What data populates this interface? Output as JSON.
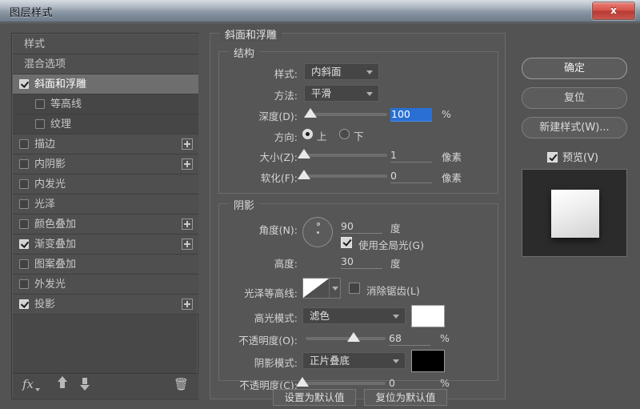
{
  "window": {
    "title": "图层样式",
    "close_label": "x"
  },
  "styles_panel": {
    "rows": [
      {
        "label": "样式",
        "type": "header",
        "checked": null,
        "plus": false,
        "selected": false
      },
      {
        "label": "混合选项",
        "type": "top",
        "checked": null,
        "plus": false,
        "selected": false
      },
      {
        "label": "斜面和浮雕",
        "type": "item",
        "checked": true,
        "plus": false,
        "selected": true
      },
      {
        "label": "等高线",
        "type": "sub",
        "checked": false,
        "plus": false,
        "selected": false
      },
      {
        "label": "纹理",
        "type": "sub",
        "checked": false,
        "plus": false,
        "selected": false
      },
      {
        "label": "描边",
        "type": "item",
        "checked": false,
        "plus": true,
        "selected": false
      },
      {
        "label": "内阴影",
        "type": "item",
        "checked": false,
        "plus": true,
        "selected": false
      },
      {
        "label": "内发光",
        "type": "item",
        "checked": false,
        "plus": false,
        "selected": false
      },
      {
        "label": "光泽",
        "type": "item",
        "checked": false,
        "plus": false,
        "selected": false
      },
      {
        "label": "颜色叠加",
        "type": "item",
        "checked": false,
        "plus": true,
        "selected": false
      },
      {
        "label": "渐变叠加",
        "type": "item",
        "checked": true,
        "plus": true,
        "selected": false
      },
      {
        "label": "图案叠加",
        "type": "item",
        "checked": false,
        "plus": false,
        "selected": false
      },
      {
        "label": "外发光",
        "type": "item",
        "checked": false,
        "plus": false,
        "selected": false
      },
      {
        "label": "投影",
        "type": "item",
        "checked": true,
        "plus": true,
        "selected": false
      }
    ],
    "toolbar": {
      "fx_label": "fx",
      "up_label": "上移效果",
      "down_label": "下移效果",
      "trash_label": "删除效果"
    }
  },
  "options": {
    "panel_title": "斜面和浮雕",
    "structure": {
      "legend": "结构",
      "style_label": "样式:",
      "style_value": "内斜面",
      "method_label": "方法:",
      "method_value": "平滑",
      "depth_label": "深度(D):",
      "depth_value": "100",
      "depth_unit": "%",
      "direction_label": "方向:",
      "direction_up": "上",
      "direction_down": "下",
      "size_label": "大小(Z):",
      "size_value": "1",
      "size_unit": "像素",
      "soften_label": "软化(F):",
      "soften_value": "0",
      "soften_unit": "像素"
    },
    "shading": {
      "legend": "阴影",
      "angle_label": "角度(N):",
      "angle_value": "90",
      "angle_unit": "度",
      "global_light_label": "使用全局光(G)",
      "altitude_label": "高度:",
      "altitude_value": "30",
      "altitude_unit": "度",
      "gloss_contour_label": "光泽等高线:",
      "antialias_label": "消除锯齿(L)",
      "highlight_mode_label": "高光模式:",
      "highlight_mode_value": "滤色",
      "highlight_color": "#ffffff",
      "highlight_opacity_label": "不透明度(O):",
      "highlight_opacity_value": "68",
      "highlight_opacity_unit": "%",
      "shadow_mode_label": "阴影模式:",
      "shadow_mode_value": "正片叠底",
      "shadow_color": "#000000",
      "shadow_opacity_label": "不透明度(C):",
      "shadow_opacity_value": "0",
      "shadow_opacity_unit": "%"
    },
    "set_default_label": "设置为默认值",
    "reset_default_label": "复位为默认值"
  },
  "right_panel": {
    "ok_label": "确定",
    "reset_label": "复位",
    "new_style_label": "新建样式(W)...",
    "preview_label": "预览(V)",
    "preview_checked": true
  },
  "colors": {
    "dialog_bg": "#535353",
    "panel_bg": "#565656",
    "selection_blue": "#2a6fd4",
    "text": "#d4d4d4"
  }
}
